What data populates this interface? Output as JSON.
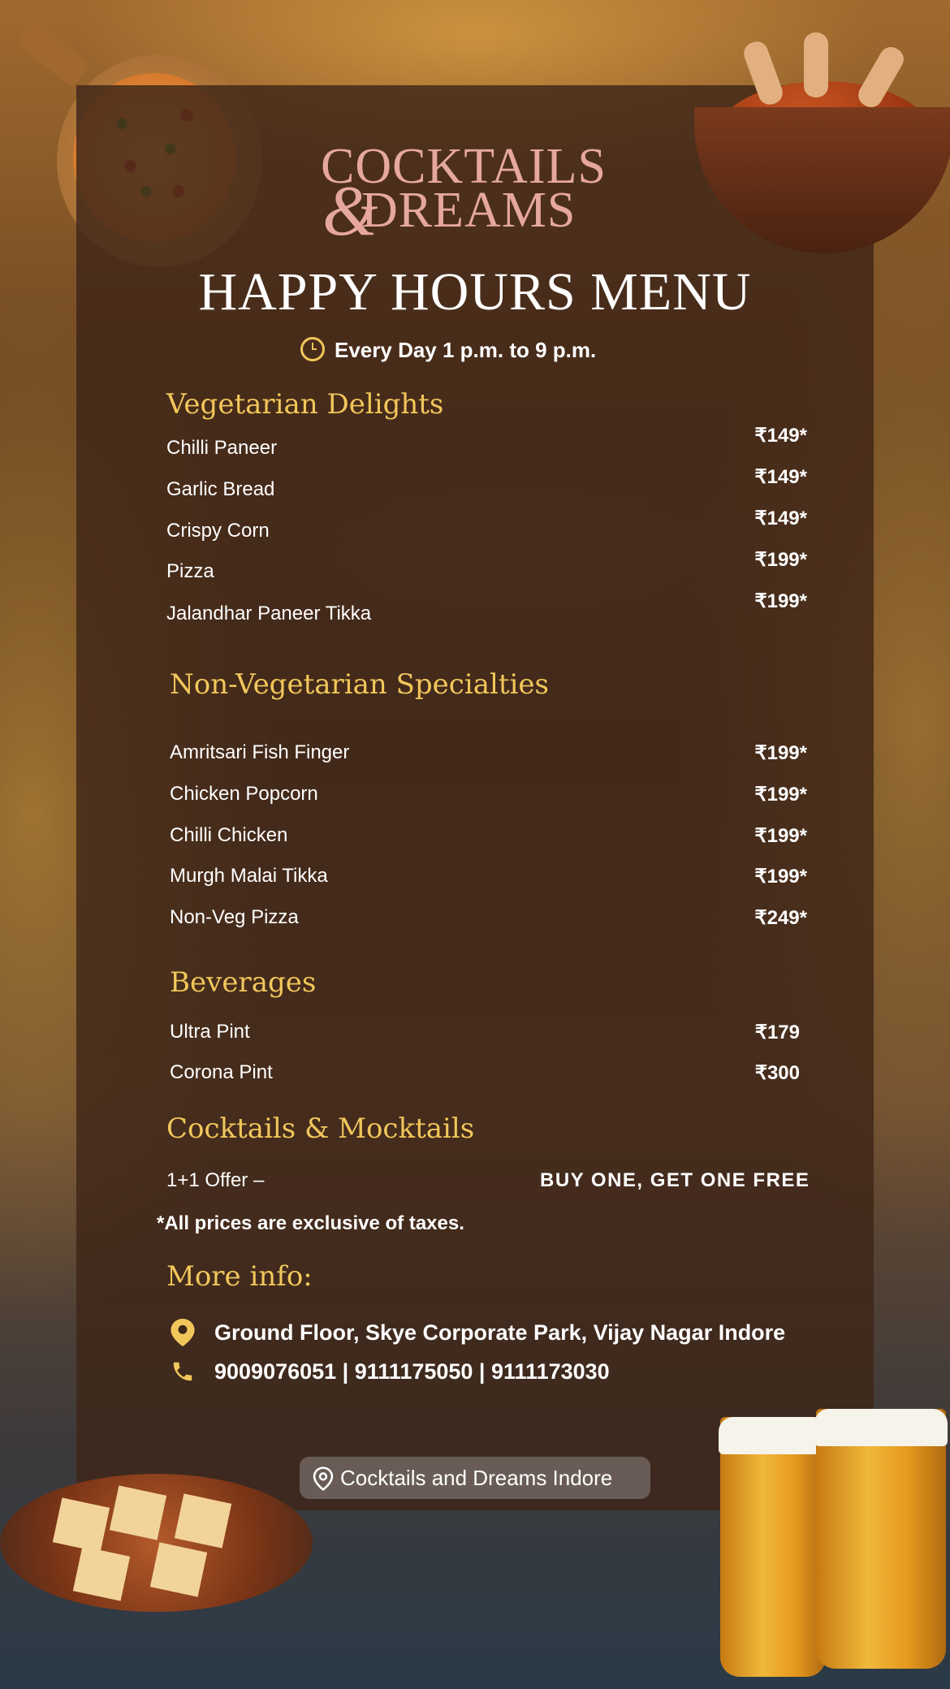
{
  "brand": {
    "line1": "COCKTAILS",
    "amp": "&",
    "line2": "DREAMS"
  },
  "title": "HAPPY HOURS MENU",
  "hours": "Every Day 1 p.m. to 9 p.m.",
  "sections": {
    "veg": {
      "heading": "Vegetarian Delights",
      "items": [
        {
          "name": "Chilli Paneer",
          "price": "₹149*"
        },
        {
          "name": "Garlic Bread",
          "price": "₹149*"
        },
        {
          "name": "Crispy Corn",
          "price": "₹149*"
        },
        {
          "name": "Pizza",
          "price": "₹199*"
        },
        {
          "name": "Jalandhar Paneer Tikka",
          "price": "₹199*"
        }
      ]
    },
    "nonveg": {
      "heading": "Non-Vegetarian Specialties",
      "items": [
        {
          "name": "Amritsari Fish Finger",
          "price": "₹199*"
        },
        {
          "name": "Chicken Popcorn",
          "price": "₹199*"
        },
        {
          "name": "Chilli Chicken",
          "price": "₹199*"
        },
        {
          "name": "Murgh Malai Tikka",
          "price": "₹199*"
        },
        {
          "name": "Non-Veg Pizza",
          "price": "₹249*"
        }
      ]
    },
    "beverages": {
      "heading": "Beverages",
      "items": [
        {
          "name": "Ultra Pint",
          "price": "₹179"
        },
        {
          "name": "Corona Pint",
          "price": "₹300"
        }
      ]
    },
    "cocktails": {
      "heading": "Cocktails & Mocktails",
      "offer_label": "1+1 Offer –",
      "offer_value": "BUY ONE, GET ONE FREE"
    }
  },
  "note": "*All prices are exclusive of taxes.",
  "info": {
    "heading": "More info:",
    "address": "Ground Floor, Skye Corporate Park, Vijay Nagar Indore",
    "phones": "9009076051 | 9111175050 | 9111173030"
  },
  "map_button": "Cocktails and Dreams Indore",
  "colors": {
    "accent": "#f1c75b",
    "logo": "#e6a7a0",
    "panel": "#3e2618"
  },
  "icons": [
    "clock-icon",
    "location-pin-icon",
    "phone-icon"
  ]
}
